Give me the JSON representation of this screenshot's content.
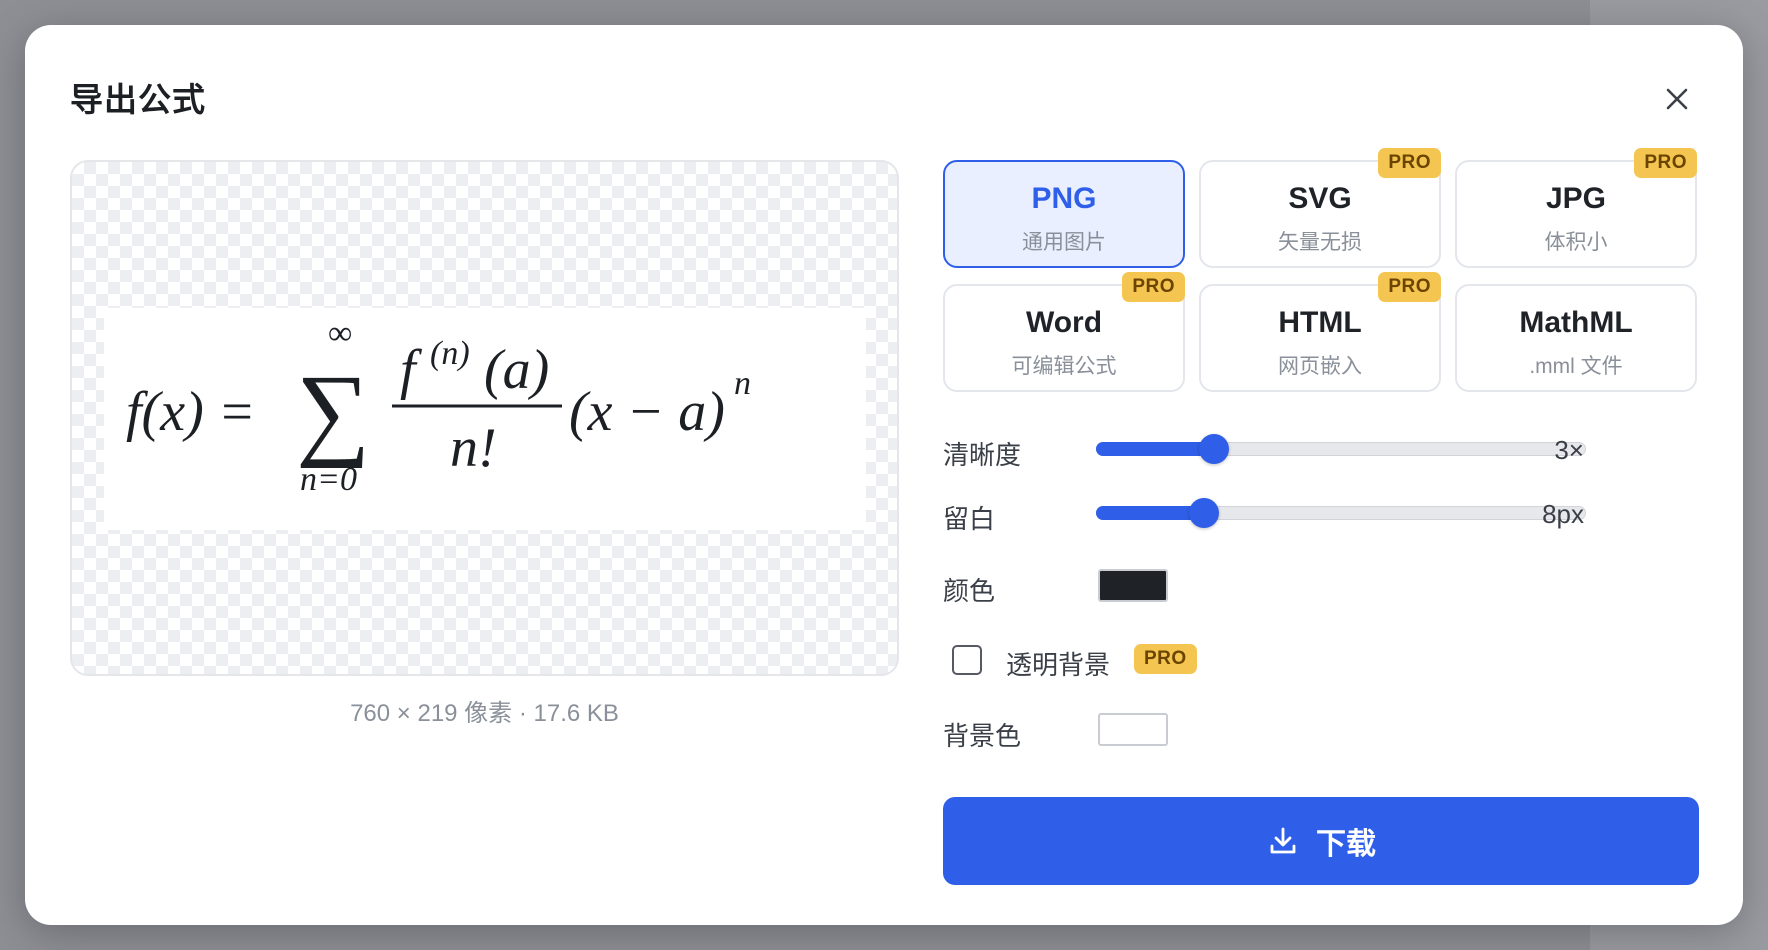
{
  "dialog": {
    "title": "导出公式",
    "close_icon": "close-icon"
  },
  "preview": {
    "formula": {
      "lhs": "f(x) =",
      "sum_symbol": "∑",
      "sum_upper": "∞",
      "sum_lower": "n=0",
      "numerator_f": "f",
      "numerator_sup": "(n)",
      "numerator_arg": "(a)",
      "denominator": "n!",
      "factor": "(x − a)",
      "factor_exp": "n"
    },
    "info": "760 × 219 像素 · 17.6 KB"
  },
  "formats": [
    {
      "name": "PNG",
      "desc": "通用图片",
      "pro": false,
      "selected": true
    },
    {
      "name": "SVG",
      "desc": "矢量无损",
      "pro": true,
      "selected": false
    },
    {
      "name": "JPG",
      "desc": "体积小",
      "pro": true,
      "selected": false
    },
    {
      "name": "Word",
      "desc": "可编辑公式",
      "pro": true,
      "selected": false
    },
    {
      "name": "HTML",
      "desc": "网页嵌入",
      "pro": true,
      "selected": false
    },
    {
      "name": "MathML",
      "desc": ".mml 文件",
      "pro": false,
      "selected": false
    }
  ],
  "pro_badge": "PRO",
  "settings": {
    "resolution": {
      "label": "清晰度",
      "value_text": "3×",
      "fraction": 0.24
    },
    "padding": {
      "label": "留白",
      "value_text": "8px",
      "fraction": 0.22
    },
    "color": {
      "label": "颜色",
      "value": "#1f2227"
    },
    "transparent": {
      "label": "透明背景",
      "checked": false,
      "pro": true
    },
    "background": {
      "label": "背景色",
      "value": "#ffffff"
    }
  },
  "download": {
    "label": "下载",
    "icon": "download-icon"
  },
  "colors": {
    "accent": "#2f5fe8",
    "pro_badge": "#f4c550",
    "selected_bg": "#e9efff"
  }
}
